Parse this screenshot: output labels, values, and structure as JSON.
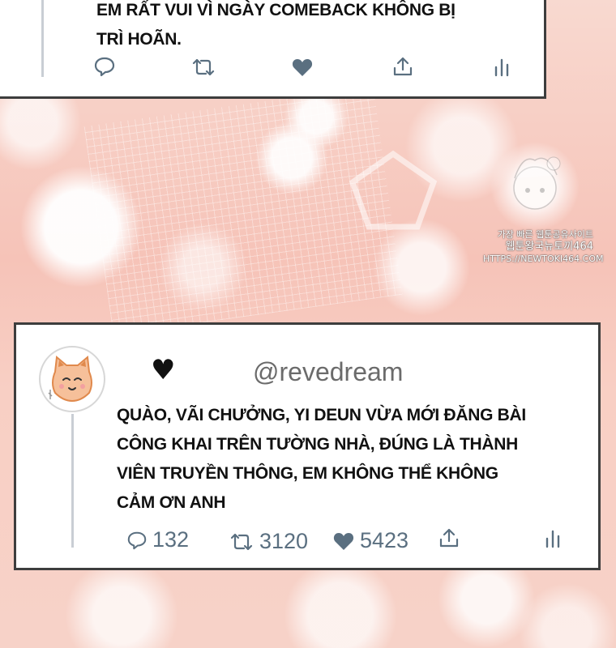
{
  "top_tweet": {
    "text_lines": [
      "EM RẤT VUI VÌ NGÀY COMEBACK KHÔNG BỊ",
      "TRÌ HOÃN."
    ],
    "icons": [
      "reply-icon",
      "retweet-icon",
      "heart-icon",
      "share-icon",
      "analytics-icon"
    ]
  },
  "main_tweet": {
    "heart_symbol": "♥",
    "handle": "@revedream",
    "text_lines": [
      "QUÀO, VÃI CHƯỞNG, YI DEUN VỪA MỚI ĐĂNG BÀI",
      "CÔNG KHAI TRÊN TƯỜNG NHÀ, ĐÚNG LÀ THÀNH",
      "VIÊN TRUYỀN THÔNG, EM KHÔNG THỂ KHÔNG",
      "CẢM ƠN ANH"
    ],
    "reply_count": "132",
    "retweet_count": "3120",
    "like_count": "5423",
    "avatar_icon": "cat-face-icon"
  },
  "watermark": {
    "line1": "가장 빠른 웹툰공유사이트",
    "line2": "웹툰왕국뉴토끼464",
    "line3": "HTTPS://NEWTOKI464.COM"
  },
  "colors": {
    "background": "#f7cfc6",
    "card": "#ffffff",
    "border": "#3d3d3d",
    "icon": "#5a6f80",
    "thread_line": "#c9ced4"
  }
}
